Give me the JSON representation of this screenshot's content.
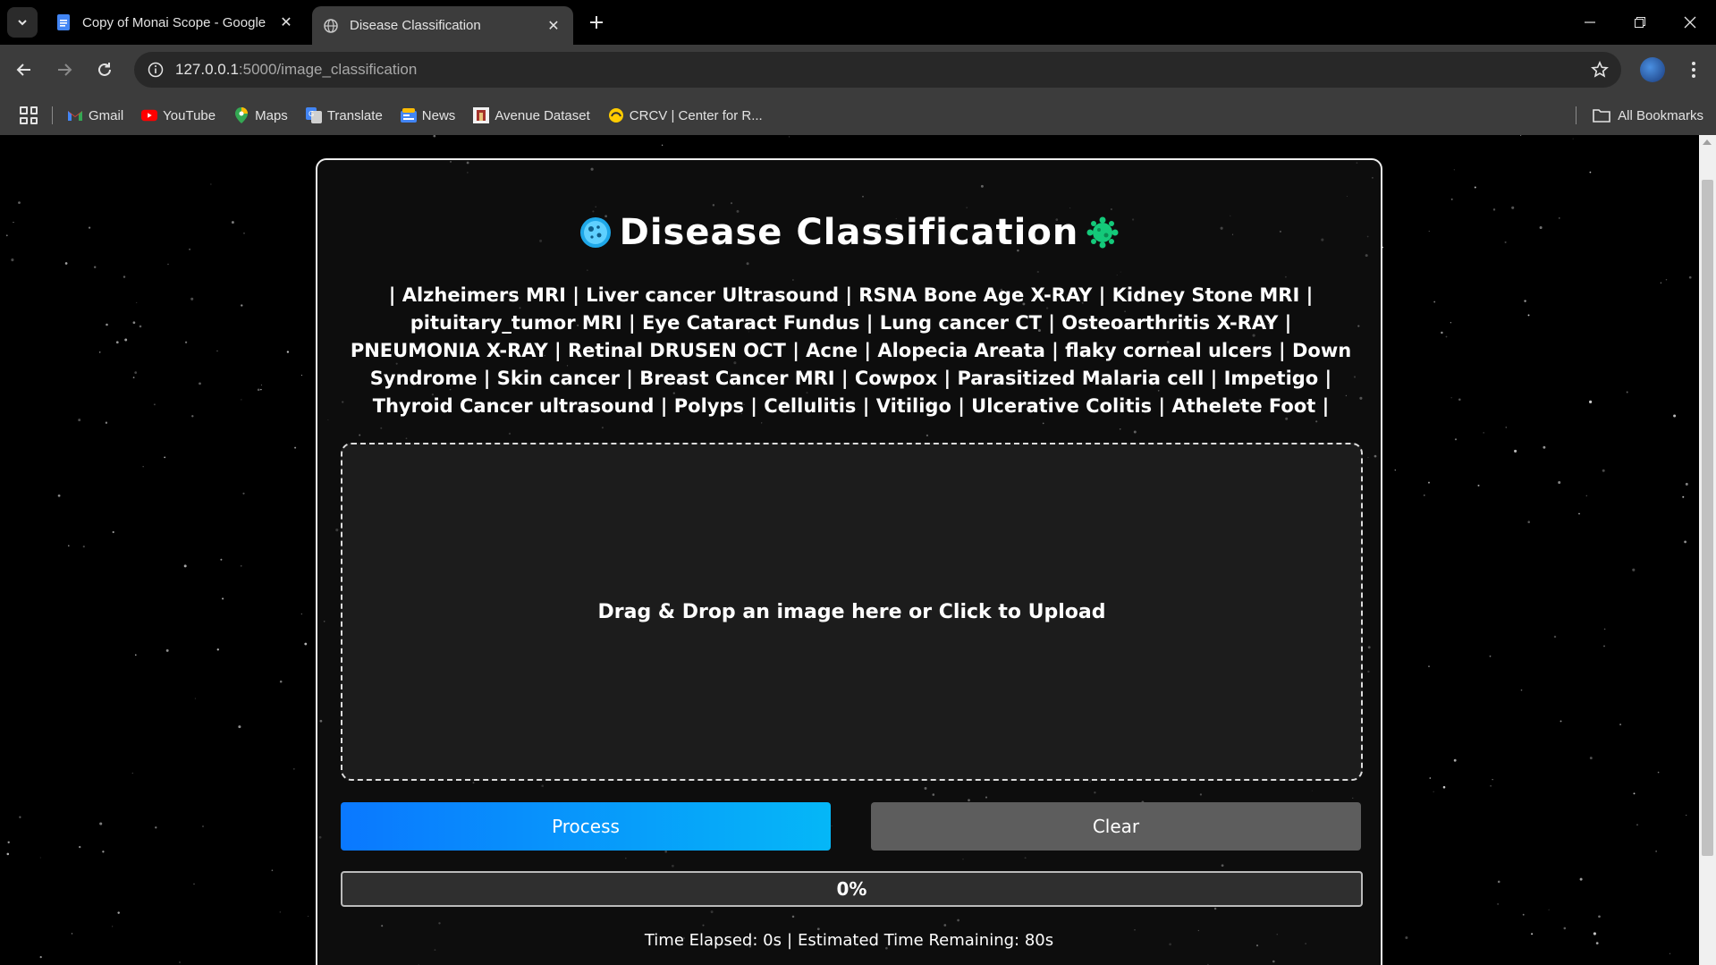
{
  "browser": {
    "tabs": [
      {
        "title": "Copy of Monai Scope - Google",
        "icon": "google-docs-icon",
        "active": false
      },
      {
        "title": "Disease Classification",
        "icon": "globe-icon",
        "active": true
      }
    ],
    "url": {
      "host": "127.0.0.1",
      "path": ":5000/image_classification"
    },
    "bookmarks": [
      {
        "label": "Gmail",
        "icon": "gmail-icon"
      },
      {
        "label": "YouTube",
        "icon": "youtube-icon"
      },
      {
        "label": "Maps",
        "icon": "maps-icon"
      },
      {
        "label": "Translate",
        "icon": "translate-icon"
      },
      {
        "label": "News",
        "icon": "news-icon"
      },
      {
        "label": "Avenue Dataset",
        "icon": "avenue-icon"
      },
      {
        "label": "CRCV | Center for R...",
        "icon": "crcv-icon"
      }
    ],
    "all_bookmarks": "All Bookmarks"
  },
  "page": {
    "title": "Disease Classification",
    "disease_list": "| Alzheimers MRI | Liver cancer Ultrasound | RSNA Bone Age X-RAY | Kidney Stone MRI | pituitary_tumor MRI | Eye Cataract Fundus | Lung cancer CT | Osteoarthritis X-RAY | PNEUMONIA X-RAY | Retinal DRUSEN OCT | Acne | Alopecia Areata | flaky corneal ulcers | Down Syndrome | Skin cancer | Breast Cancer MRI | Cowpox | Parasitized Malaria cell | Impetigo | Thyroid Cancer ultrasound | Polyps | Cellulitis | Vitiligo | Ulcerative Colitis | Athelete Foot |",
    "dropzone_text": "Drag & Drop an image here or Click to Upload",
    "process_label": "Process",
    "clear_label": "Clear",
    "progress": {
      "value": 0,
      "label": "0%"
    },
    "time_elapsed": "Time Elapsed: 0s",
    "time_remaining": "Estimated Time Remaining: 80s"
  },
  "colors": {
    "process_gradient_start": "#0a78ff",
    "process_gradient_end": "#05b7f7",
    "clear_bg": "#5d5d5d",
    "page_bg": "#000000"
  }
}
